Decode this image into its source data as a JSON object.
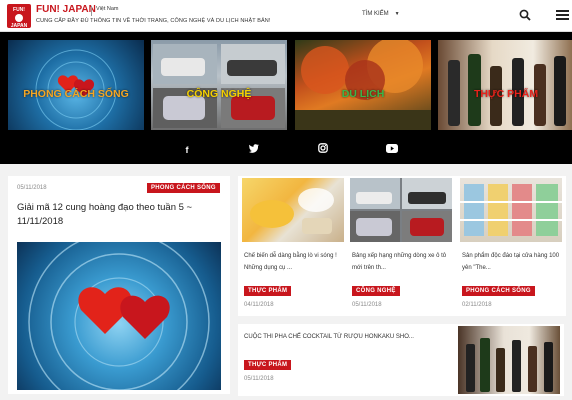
{
  "header": {
    "logo_text": "FUN! JAPAN",
    "brand": "FUN! JAPAN",
    "language": "Việt Nam",
    "tagline": "CUNG CẤP ĐẦY ĐỦ THÔNG TIN VỀ THỜI TRANG, CÔNG NGHỆ VÀ DU LỊCH NHẬT BẢN!",
    "search_label": "TÌM KIẾM",
    "search_caret": "▼",
    "accent_color": "#c8161d"
  },
  "categories": [
    {
      "label": "PHONG CÁCH SỐNG",
      "color": "#f5a623"
    },
    {
      "label": "CÔNG NGHỆ",
      "color": "#f5d000"
    },
    {
      "label": "DU LỊCH",
      "color": "#3ab54a"
    },
    {
      "label": "THỰC PHẨM",
      "color": "#e8231b"
    }
  ],
  "social": [
    {
      "name": "facebook-icon",
      "glyph": "f"
    },
    {
      "name": "twitter-icon",
      "glyph": "🐦"
    },
    {
      "name": "instagram-icon",
      "glyph": "◎"
    },
    {
      "name": "youtube-icon",
      "glyph": "▶"
    }
  ],
  "main_article": {
    "date": "05/11/2018",
    "category": "PHONG CÁCH SỐNG",
    "title": "Giải mã 12 cung hoàng đạo theo tuần  5 ~ 11/11/2018"
  },
  "articles": [
    {
      "text": "Chế biến dễ dàng bằng lò vi sóng ! Những dụng cụ ...",
      "category": "THỰC PHẨM",
      "date": "04/11/2018"
    },
    {
      "text": "Bảng xếp hạng những dòng xe ô tô mới trên th...",
      "category": "CÔNG NGHỆ",
      "date": "05/11/2018"
    },
    {
      "text": "Sản phẩm độc đáo tại cửa hàng 100 yên \"The...",
      "category": "PHONG CÁCH SỐNG",
      "date": "02/11/2018"
    }
  ],
  "wide_article": {
    "text": "CUỘC THI PHA CHẾ COCKTAIL TỪ RƯỢU HONKAKU SHO...",
    "category": "THỰC PHẨM",
    "date": "05/11/2018"
  }
}
